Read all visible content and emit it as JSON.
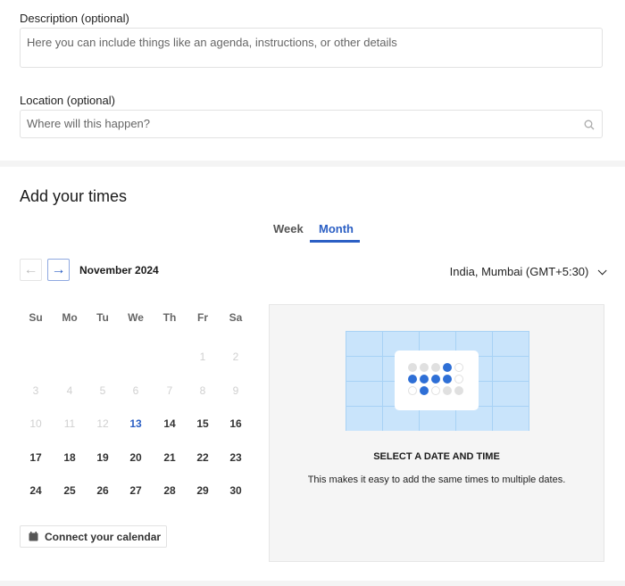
{
  "description": {
    "label": "Description (optional)",
    "placeholder": "Here you can include things like an agenda, instructions, or other details"
  },
  "location": {
    "label": "Location (optional)",
    "placeholder": "Where will this happen?"
  },
  "times": {
    "title": "Add your times",
    "tabs": [
      "Week",
      "Month"
    ],
    "active_tab": "Month",
    "month": "November 2024",
    "timezone": "India, Mumbai (GMT+5:30)",
    "weekdays": [
      "Su",
      "Mo",
      "Tu",
      "We",
      "Th",
      "Fr",
      "Sa"
    ],
    "first_weekday_index": 5,
    "days_in_month": 30,
    "today": 13,
    "connect_label": "Connect your calendar",
    "panel": {
      "title": "SELECT A DATE AND TIME",
      "subtitle": "This makes it easy to add the same times to multiple dates.",
      "dots": [
        "g",
        "g",
        "g",
        "b",
        "w",
        "b",
        "b",
        "b",
        "b",
        "w",
        "w",
        "b",
        "w",
        "g",
        "g"
      ]
    }
  },
  "colors": {
    "accent": "#2b5fc4"
  }
}
